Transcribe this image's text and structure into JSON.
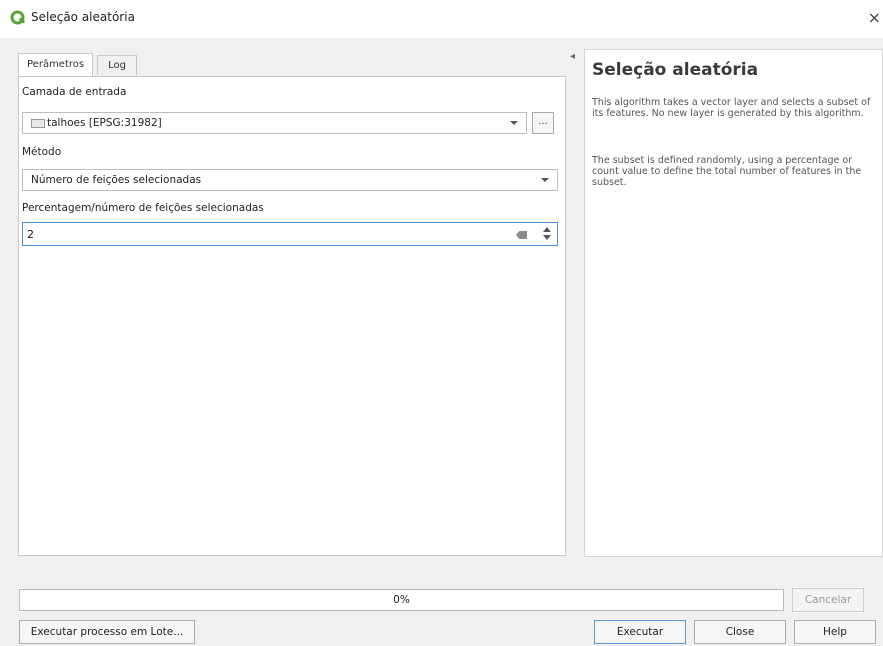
{
  "window": {
    "title": "Seleção aleatória",
    "close_glyph": "×",
    "icon": "qgis-logo-icon",
    "accent_color": "#5aa33c"
  },
  "tabs": [
    {
      "label": "Perâmetros",
      "active": true
    },
    {
      "label": "Log",
      "active": false
    }
  ],
  "params": {
    "input_layer_label": "Camada de entrada",
    "input_layer_value": "talhoes [EPSG:31982]",
    "browse_label": "...",
    "method_label": "Método",
    "method_value": "Número de feições selecionadas",
    "count_label": "Percentagem/número de feições selecionadas",
    "count_value": "2"
  },
  "help": {
    "title": "Seleção aleatória",
    "paragraph1": "This algorithm takes a vector layer and selects a subset of its features. No new layer is generated by this algorithm.",
    "paragraph2": "The subset is defined randomly, using a percentage or count value to define the total number of features in the subset."
  },
  "progress": {
    "text": "0%",
    "fraction": 0
  },
  "buttons": {
    "cancel": "Cancelar",
    "batch": "Executar processo em Lote...",
    "run": "Executar",
    "close": "Close",
    "help": "Help"
  }
}
